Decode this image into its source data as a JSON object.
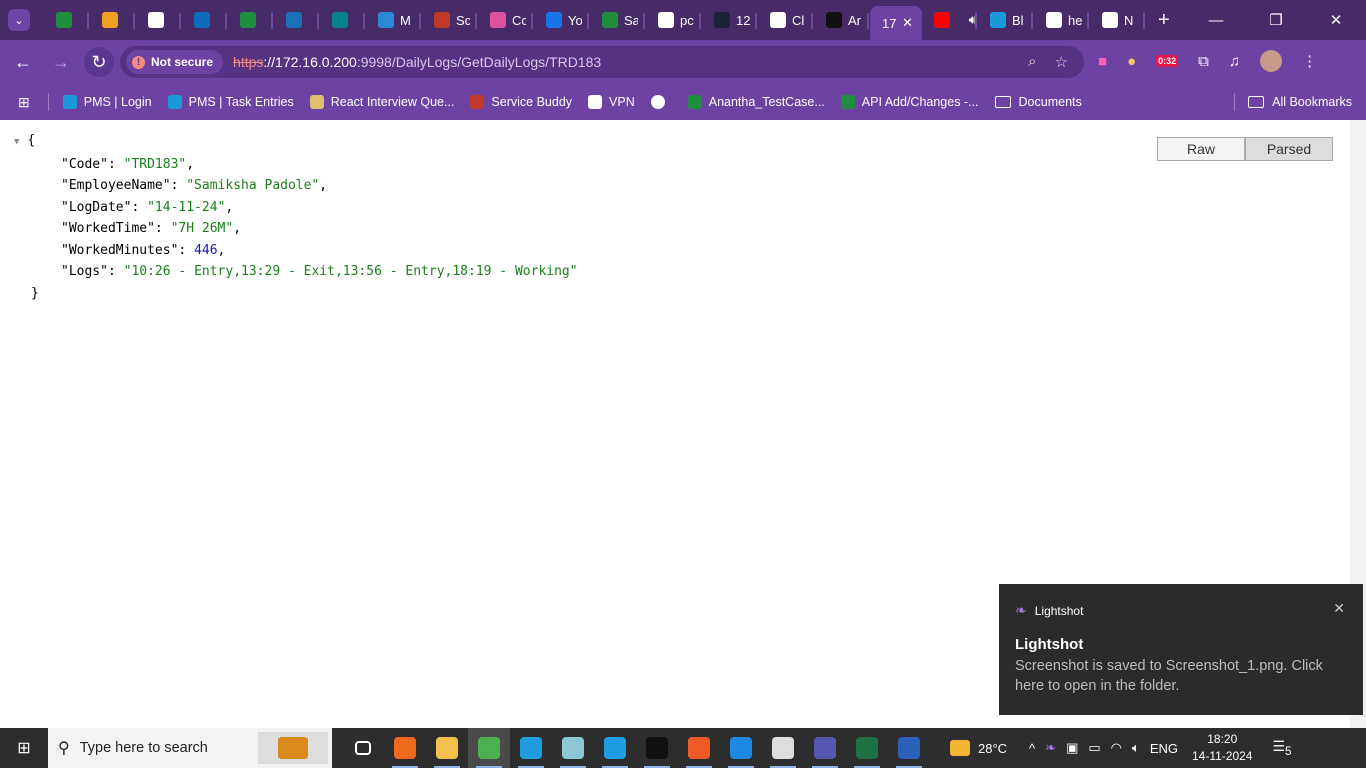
{
  "browser": {
    "tabs": [
      {
        "title": "",
        "favicon": "sheets-icon",
        "color": "#1e8e3e"
      },
      {
        "title": "",
        "favicon": "emoji-icon",
        "color": "#f0a020"
      },
      {
        "title": "",
        "favicon": "pms-icon",
        "color": "#ffffff"
      },
      {
        "title": "",
        "favicon": "outlook-icon",
        "color": "#0f6cbd"
      },
      {
        "title": "",
        "favicon": "sheets-icon",
        "color": "#1e8e3e"
      },
      {
        "title": "",
        "favicon": "azure-icon",
        "color": "#1a73b8"
      },
      {
        "title": "",
        "favicon": "sharepoint-icon",
        "color": "#038387"
      },
      {
        "title": "M",
        "favicon": "k-icon",
        "color": "#2a8ad8"
      },
      {
        "title": "Sc",
        "favicon": "service-buddy-icon",
        "color": "#c0392b"
      },
      {
        "title": "Cc",
        "favicon": "play-icon",
        "color": "#e04fa0"
      },
      {
        "title": "Yo",
        "favicon": "s-icon",
        "color": "#1a73e8"
      },
      {
        "title": "Sa",
        "favicon": "sheets-icon",
        "color": "#1e8e3e"
      },
      {
        "title": "pc",
        "favicon": "google-icon",
        "color": "#ffffff"
      },
      {
        "title": "12",
        "favicon": "el-icon",
        "color": "#1b2436"
      },
      {
        "title": "Cl",
        "favicon": "chatgpt-icon",
        "color": "#ffffff"
      },
      {
        "title": "Ar",
        "favicon": "m-icon",
        "color": "#111111"
      },
      {
        "title": "17",
        "favicon": "",
        "color": "",
        "active": true
      },
      {
        "title": "",
        "favicon": "youtube-icon",
        "color": "#ff0000"
      },
      {
        "title": "Bl",
        "favicon": "pms-icon",
        "color": "#1a9ad8"
      },
      {
        "title": "he",
        "favicon": "google-icon",
        "color": "#ffffff"
      },
      {
        "title": "N",
        "favicon": "chrome-icon",
        "color": "#ffffff"
      }
    ],
    "security_label": "Not secure",
    "url_scheme": "https",
    "url_host": "://172.16.0.200",
    "url_path": ":9998/DailyLogs/GetDailyLogs/TRD183",
    "extension_badge": "0:32",
    "bookmarks": [
      {
        "label": "PMS | Login",
        "color": "#1a9ad8"
      },
      {
        "label": "PMS | Task Entries",
        "color": "#1a9ad8"
      },
      {
        "label": "React Interview Que...",
        "color": "#e0c070"
      },
      {
        "label": "Service Buddy",
        "color": "#c0392b"
      },
      {
        "label": "VPN",
        "color": "#ffffff"
      },
      {
        "label": "",
        "color": "#ffffff"
      },
      {
        "label": "Anantha_TestCase...",
        "color": "#1e8e3e"
      },
      {
        "label": "API Add/Changes -...",
        "color": "#1e8e3e"
      }
    ],
    "bookmark_folder": "Documents",
    "all_bookmarks": "All Bookmarks"
  },
  "viewer": {
    "raw_label": "Raw",
    "parsed_label": "Parsed",
    "open_brace": "{",
    "close_brace": "}",
    "fields": [
      {
        "key": "\"Code\"",
        "value": "\"TRD183\"",
        "type": "string",
        "comma": ","
      },
      {
        "key": "\"EmployeeName\"",
        "value": "\"Samiksha Padole\"",
        "type": "string",
        "comma": ","
      },
      {
        "key": "\"LogDate\"",
        "value": "\"14-11-24\"",
        "type": "string",
        "comma": ","
      },
      {
        "key": "\"WorkedTime\"",
        "value": "\"7H 26M\"",
        "type": "string",
        "comma": ","
      },
      {
        "key": "\"WorkedMinutes\"",
        "value": "446",
        "type": "number",
        "comma": ","
      },
      {
        "key": "\"Logs\"",
        "value": "\"10:26 - Entry,13:29 - Exit,13:56 - Entry,18:19 - Working\"",
        "type": "string",
        "comma": ""
      }
    ]
  },
  "toast": {
    "app": "Lightshot",
    "title": "Lightshot",
    "body": "Screenshot is saved to Screenshot_1.png. Click here to open in the folder."
  },
  "taskbar": {
    "search_placeholder": "Type here to search",
    "apps": [
      {
        "name": "task-view",
        "color": "#2d2d2d"
      },
      {
        "name": "app-orange",
        "color": "#f06a1c",
        "run": true
      },
      {
        "name": "file-explorer",
        "color": "#f2c14e",
        "run": true
      },
      {
        "name": "chrome",
        "color": "#4caf50",
        "run": true,
        "active": true
      },
      {
        "name": "edge",
        "color": "#1f9bde",
        "run": true
      },
      {
        "name": "notes",
        "color": "#8fc7d6",
        "run": true
      },
      {
        "name": "skype",
        "color": "#1e9ce0",
        "run": true
      },
      {
        "name": "terminal",
        "color": "#111111",
        "run": true
      },
      {
        "name": "postman",
        "color": "#ef5b25",
        "run": true
      },
      {
        "name": "vscode",
        "color": "#1e88e5",
        "run": true
      },
      {
        "name": "settings",
        "color": "#dddddd",
        "run": true
      },
      {
        "name": "teams",
        "color": "#5558af",
        "run": true
      },
      {
        "name": "excel",
        "color": "#1d7044",
        "run": true
      },
      {
        "name": "word",
        "color": "#2b5fb8",
        "run": true
      }
    ],
    "temperature": "28°C",
    "language": "ENG",
    "time": "18:20",
    "date": "14-11-2024",
    "notification_count": "5"
  }
}
